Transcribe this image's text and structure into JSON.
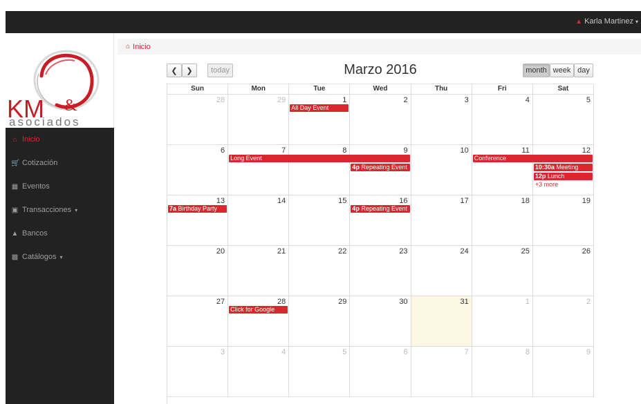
{
  "navbar": {
    "user_name": "Karla Martinez"
  },
  "logo": {
    "line1": "KM",
    "amp": "&",
    "line2": "asociados"
  },
  "sidebar": {
    "items": [
      {
        "label": "Inicio",
        "icon": "home-icon",
        "active": true
      },
      {
        "label": "Cotización",
        "icon": "cart-icon"
      },
      {
        "label": "Eventos",
        "icon": "calendar-icon"
      },
      {
        "label": "Transacciones",
        "icon": "money-icon",
        "dropdown": true
      },
      {
        "label": "Bancos",
        "icon": "bank-icon"
      },
      {
        "label": "Catálogos",
        "icon": "book-icon",
        "dropdown": true
      }
    ]
  },
  "breadcrumb": {
    "label": "Inicio"
  },
  "toolbar": {
    "today_label": "today",
    "month_label": "month",
    "week_label": "week",
    "day_label": "day"
  },
  "calendar": {
    "title": "Marzo 2016",
    "dow": [
      "Sun",
      "Mon",
      "Tue",
      "Wed",
      "Thu",
      "Fri",
      "Sat"
    ],
    "weeks": [
      [
        {
          "d": "28",
          "o": true
        },
        {
          "d": "29",
          "o": true
        },
        {
          "d": "1"
        },
        {
          "d": "2"
        },
        {
          "d": "3"
        },
        {
          "d": "4"
        },
        {
          "d": "5"
        }
      ],
      [
        {
          "d": "6"
        },
        {
          "d": "7"
        },
        {
          "d": "8"
        },
        {
          "d": "9"
        },
        {
          "d": "10"
        },
        {
          "d": "11"
        },
        {
          "d": "12"
        }
      ],
      [
        {
          "d": "13"
        },
        {
          "d": "14"
        },
        {
          "d": "15"
        },
        {
          "d": "16"
        },
        {
          "d": "17"
        },
        {
          "d": "18"
        },
        {
          "d": "19"
        }
      ],
      [
        {
          "d": "20"
        },
        {
          "d": "21"
        },
        {
          "d": "22"
        },
        {
          "d": "23"
        },
        {
          "d": "24"
        },
        {
          "d": "25"
        },
        {
          "d": "26"
        }
      ],
      [
        {
          "d": "27"
        },
        {
          "d": "28"
        },
        {
          "d": "29"
        },
        {
          "d": "30"
        },
        {
          "d": "31",
          "today": true
        },
        {
          "d": "1",
          "o": true
        },
        {
          "d": "2",
          "o": true
        }
      ],
      [
        {
          "d": "3",
          "o": true
        },
        {
          "d": "4",
          "o": true
        },
        {
          "d": "5",
          "o": true
        },
        {
          "d": "6",
          "o": true
        },
        {
          "d": "7",
          "o": true
        },
        {
          "d": "8",
          "o": true
        },
        {
          "d": "9",
          "o": true
        }
      ]
    ],
    "events": [
      {
        "week": 0,
        "start": 2,
        "span": 1,
        "slot": 0,
        "time": "",
        "title": "All Day Event"
      },
      {
        "week": 1,
        "start": 1,
        "span": 3,
        "slot": 0,
        "time": "",
        "title": "Long Event"
      },
      {
        "week": 1,
        "start": 5,
        "span": 2,
        "slot": 0,
        "time": "",
        "title": "Conference"
      },
      {
        "week": 1,
        "start": 3,
        "span": 1,
        "slot": 1,
        "time": "4p",
        "title": "Repeating Event"
      },
      {
        "week": 1,
        "start": 6,
        "span": 1,
        "slot": 1,
        "time": "10:30a",
        "title": "Meeting"
      },
      {
        "week": 1,
        "start": 6,
        "span": 1,
        "slot": 2,
        "time": "12p",
        "title": "Lunch"
      },
      {
        "week": 2,
        "start": 0,
        "span": 1,
        "slot": 0,
        "time": "7a",
        "title": "Birthday Party"
      },
      {
        "week": 2,
        "start": 3,
        "span": 1,
        "slot": 0,
        "time": "4p",
        "title": "Repeating Event"
      },
      {
        "week": 4,
        "start": 1,
        "span": 1,
        "slot": 0,
        "time": "",
        "title": "Click for Google"
      }
    ],
    "more": [
      {
        "week": 1,
        "col": 6,
        "slot": 3,
        "label": "+3 more"
      }
    ]
  },
  "colors": {
    "accent": "#d9262f",
    "navbar": "#222222",
    "today_bg": "#fcf8e3"
  }
}
